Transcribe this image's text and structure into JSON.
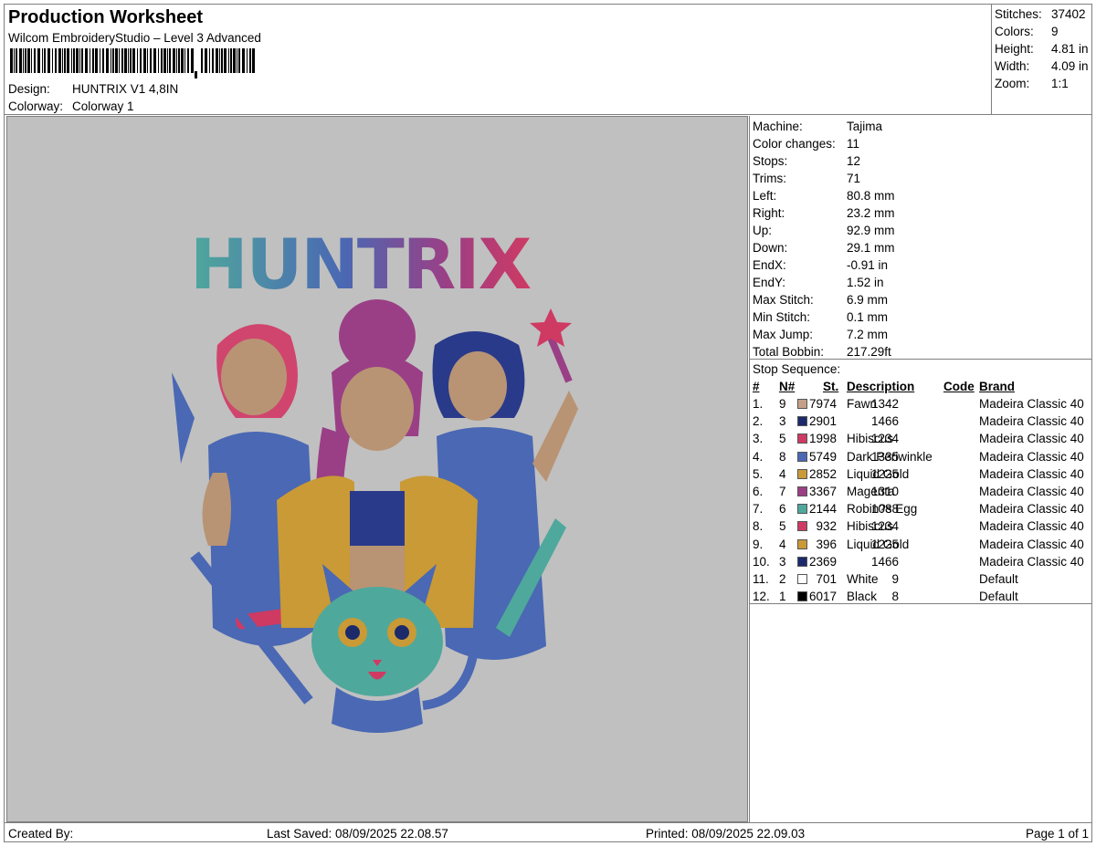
{
  "header": {
    "title": "Production Worksheet",
    "software": "Wilcom EmbroideryStudio – Level 3 Advanced",
    "design_label": "Design:",
    "design_value": "HUNTRIX V1 4,8IN",
    "colorway_label": "Colorway:",
    "colorway_value": "Colorway 1"
  },
  "stats": {
    "stitches_label": "Stitches:",
    "stitches": "37402",
    "colors_label": "Colors:",
    "colors": "9",
    "height_label": "Height:",
    "height": "4.81 in",
    "width_label": "Width:",
    "width": "4.09 in",
    "zoom_label": "Zoom:",
    "zoom": "1:1"
  },
  "preview": {
    "logo_text": "HUNTRIX"
  },
  "machine": {
    "machine_label": "Machine:",
    "machine": "Tajima",
    "color_changes_label": "Color changes:",
    "color_changes": "11",
    "stops_label": "Stops:",
    "stops": "12",
    "trims_label": "Trims:",
    "trims": "71",
    "left_label": "Left:",
    "left": "80.8 mm",
    "right_label": "Right:",
    "right": "23.2 mm",
    "up_label": "Up:",
    "up": "92.9 mm",
    "down_label": "Down:",
    "down": "29.1 mm",
    "endx_label": "EndX:",
    "endx": "-0.91 in",
    "endy_label": "EndY:",
    "endy": "1.52 in",
    "max_stitch_label": "Max Stitch:",
    "max_stitch": "6.9 mm",
    "min_stitch_label": "Min Stitch:",
    "min_stitch": "0.1 mm",
    "max_jump_label": "Max Jump:",
    "max_jump": "7.2 mm",
    "total_bobbin_label": "Total Bobbin:",
    "total_bobbin": "217.29ft"
  },
  "stop_sequence": {
    "label": "Stop Sequence:",
    "columns": {
      "num": "#",
      "n": "N#",
      "st": "St.",
      "desc": "Description",
      "code": "Code",
      "brand": "Brand"
    },
    "rows": [
      {
        "num": "1.",
        "n": "9",
        "color": "#c4a088",
        "st": "7974",
        "desc": "Fawn",
        "code": "1342",
        "brand": "Madeira Classic 40"
      },
      {
        "num": "2.",
        "n": "3",
        "color": "#1b2a6b",
        "st": "2901",
        "desc": "",
        "code": "1466",
        "brand": "Madeira Classic 40"
      },
      {
        "num": "3.",
        "n": "5",
        "color": "#cf3a63",
        "st": "1998",
        "desc": "Hibiscus",
        "code": "1234",
        "brand": "Madeira Classic 40"
      },
      {
        "num": "4.",
        "n": "8",
        "color": "#4a68b3",
        "st": "5749",
        "desc": "Dark Periwinkle",
        "code": "1335",
        "brand": "Madeira Classic 40"
      },
      {
        "num": "5.",
        "n": "4",
        "color": "#c99a36",
        "st": "2852",
        "desc": "Liquid Gold",
        "code": "1225",
        "brand": "Madeira Classic 40"
      },
      {
        "num": "6.",
        "n": "7",
        "color": "#9a3f86",
        "st": "3367",
        "desc": "Magenta",
        "code": "1310",
        "brand": "Madeira Classic 40"
      },
      {
        "num": "7.",
        "n": "6",
        "color": "#4fa89c",
        "st": "2144",
        "desc": "Robin?s Egg",
        "code": "1088",
        "brand": "Madeira Classic 40"
      },
      {
        "num": "8.",
        "n": "5",
        "color": "#cf3a63",
        "st": "932",
        "desc": "Hibiscus",
        "code": "1234",
        "brand": "Madeira Classic 40"
      },
      {
        "num": "9.",
        "n": "4",
        "color": "#c99a36",
        "st": "396",
        "desc": "Liquid Gold",
        "code": "1225",
        "brand": "Madeira Classic 40"
      },
      {
        "num": "10.",
        "n": "3",
        "color": "#1b2a6b",
        "st": "2369",
        "desc": "",
        "code": "1466",
        "brand": "Madeira Classic 40"
      },
      {
        "num": "11.",
        "n": "2",
        "color": "#ffffff",
        "st": "701",
        "desc": "White",
        "code": "9",
        "brand": "Default"
      },
      {
        "num": "12.",
        "n": "1",
        "color": "#000000",
        "st": "6017",
        "desc": "Black",
        "code": "8",
        "brand": "Default"
      }
    ]
  },
  "footer": {
    "created_by": "Created By:",
    "last_saved": "Last Saved: 08/09/2025 22.08.57",
    "printed": "Printed: 08/09/2025 22.09.03",
    "page": "Page 1 of 1"
  }
}
